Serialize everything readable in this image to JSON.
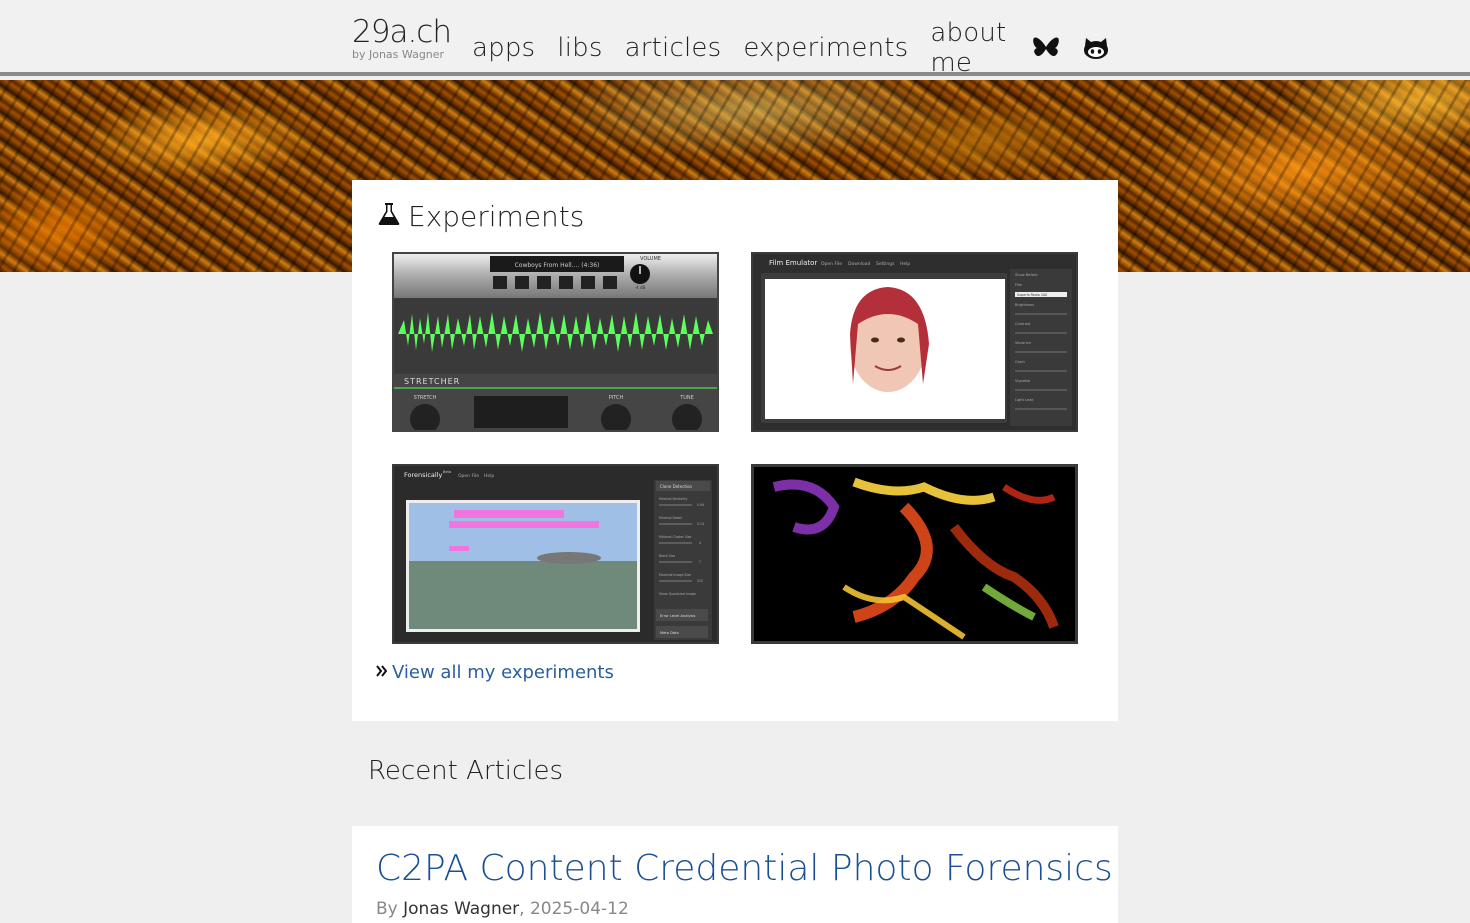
{
  "site": {
    "title": "29a.ch",
    "subtitle": "by Jonas Wagner"
  },
  "nav": {
    "items": [
      {
        "label": "apps"
      },
      {
        "label": "libs"
      },
      {
        "label": "articles"
      },
      {
        "label": "experiments"
      },
      {
        "label": "about me"
      }
    ],
    "icons": [
      "bluesky-icon",
      "github-icon"
    ]
  },
  "experiments": {
    "heading": "Experiments",
    "icon": "flask-icon",
    "thumbnails": [
      {
        "name": "stretcher",
        "header": "Cowboys From Hell.... (4:36)",
        "volume_label": "VOLUME",
        "volume_value": "-4 dB",
        "panel_label": "STRETCHER",
        "knobs": [
          "STRETCH",
          "PITCH",
          "TUNE"
        ]
      },
      {
        "name": "film-emulator",
        "title": "Film Emulator",
        "menu": [
          "Open File",
          "Download",
          "Settings",
          "Help"
        ],
        "controls": [
          "Show Before",
          "Film",
          "Superia Reala 100",
          "Brightness",
          "Contrast",
          "Vibrance",
          "Grain",
          "Vignette",
          "Light Leak"
        ]
      },
      {
        "name": "forensically",
        "title": "Forensically",
        "badge": "Beta",
        "menu": [
          "Open File",
          "Help"
        ],
        "panel": [
          "Clone Detection",
          "Minimal Similarity",
          "Minimal Detail",
          "Minimal Cluster Size",
          "Block Size",
          "Maximal Image Size",
          "Show Quantized Image",
          "Error Level Analysis",
          "Meta Data"
        ],
        "values": [
          "0.94",
          "0.14",
          "4",
          "7",
          "512"
        ]
      },
      {
        "name": "fluid-art"
      }
    ],
    "view_all_label": "View all my experiments"
  },
  "recent": {
    "heading": "Recent Articles"
  },
  "article": {
    "title": "C2PA Content Credential Photo Forensics",
    "by_label": "By",
    "author": "Jonas Wagner",
    "date": "2025-04-12"
  },
  "colors": {
    "link": "#2a5ea0",
    "article_title": "#1a4f93",
    "waveform": "#5cff5c",
    "background": "#efefef"
  }
}
